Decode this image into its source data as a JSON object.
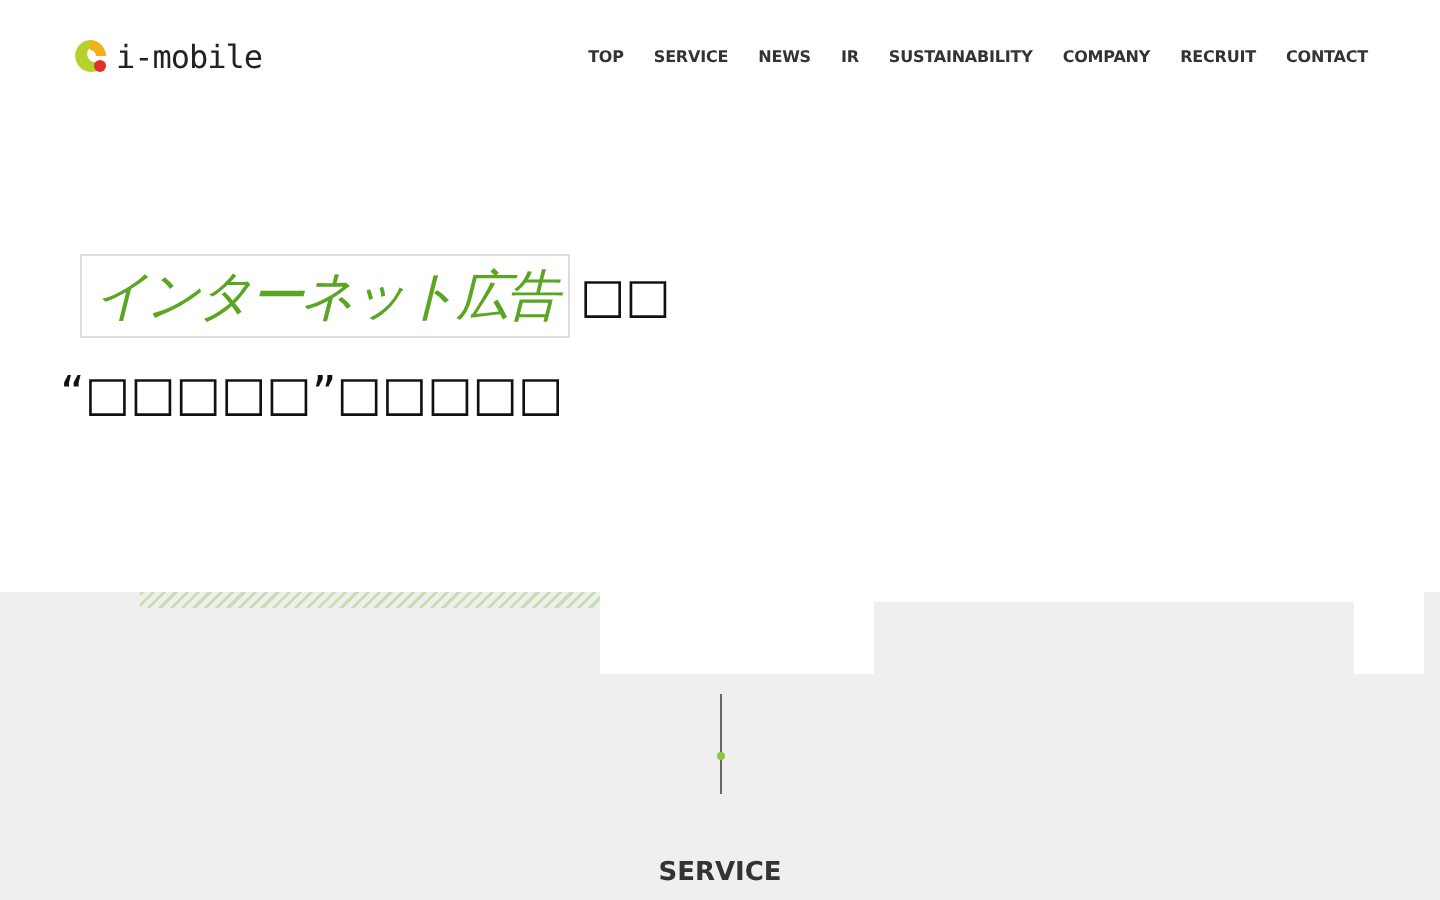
{
  "header": {
    "logo": "i-mobile",
    "nav": [
      {
        "label": "TOP"
      },
      {
        "label": "SERVICE"
      },
      {
        "label": "NEWS"
      },
      {
        "label": "IR"
      },
      {
        "label": "SUSTAINABILITY"
      },
      {
        "label": "COMPANY"
      },
      {
        "label": "RECRUIT"
      },
      {
        "label": "CONTACT"
      }
    ]
  },
  "hero": {
    "handwritten": "インターネット広告",
    "line_1_rest": "□□",
    "line_2": "“□□□□□”□□□□□"
  },
  "section": {
    "heading": "SERVICE"
  }
}
